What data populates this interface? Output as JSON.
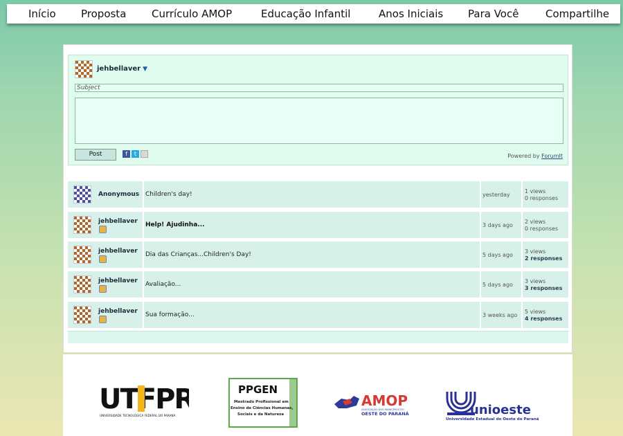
{
  "nav": {
    "items": [
      "Início",
      "Proposta",
      "Currículo AMOP",
      "Educação Infantil",
      "Anos Iniciais",
      "Para Você",
      "Compartilhe"
    ]
  },
  "composer": {
    "username": "jehbellaver",
    "caret": "▼",
    "subject_placeholder": "Subject",
    "post_label": "Post",
    "powered_by": "Powered by",
    "powered_link": "ForumIt"
  },
  "threads": [
    {
      "user": "Anonymous",
      "subject": "Children's day!",
      "bold": false,
      "date": "yesterday",
      "views": "1 views",
      "responses": "0 responses",
      "responses_bold": false
    },
    {
      "user": "jehbellaver",
      "subject": "Help! Ajudinha...",
      "bold": true,
      "date": "3 days ago",
      "views": "2 views",
      "responses": "0 responses",
      "responses_bold": false
    },
    {
      "user": "jehbellaver",
      "subject": "Dia das Crianças...Children's Day!",
      "bold": false,
      "date": "5 days ago",
      "views": "3 views",
      "responses": "2 responses",
      "responses_bold": true
    },
    {
      "user": "jehbellaver",
      "subject": "Avaliação...",
      "bold": false,
      "date": "5 days ago",
      "views": "3 views",
      "responses": "3 responses",
      "responses_bold": true
    },
    {
      "user": "jehbellaver",
      "subject": "Sua formação...",
      "bold": false,
      "date": "3 weeks ago",
      "views": "5 views",
      "responses": "4 responses",
      "responses_bold": true
    }
  ],
  "logos": {
    "utfpr": {
      "main": "UTFPR",
      "caption": "UNIVERSIDADE TECNOLÓGICA FEDERAL DO PARANÁ"
    },
    "ppgen": {
      "title": "PPGEN",
      "lines": [
        "Mestrado Profissional em",
        "Ensino de Ciências Humanas,",
        "Sociais e da Natureza"
      ]
    },
    "amop": {
      "main": "AMOP",
      "lines": [
        "ASSOCIAÇÃO DOS MUNICÍPIOS DO",
        "OESTE DO PARANÁ"
      ]
    },
    "unioeste": {
      "main": "unioeste",
      "caption": "Universidade Estadual do Oeste do Paraná"
    }
  },
  "colors": {
    "nav_bg": "#ffffff",
    "composer_bg": "#dffcef",
    "row_bg": "#d7f0e9",
    "link": "#2b4a7a"
  }
}
